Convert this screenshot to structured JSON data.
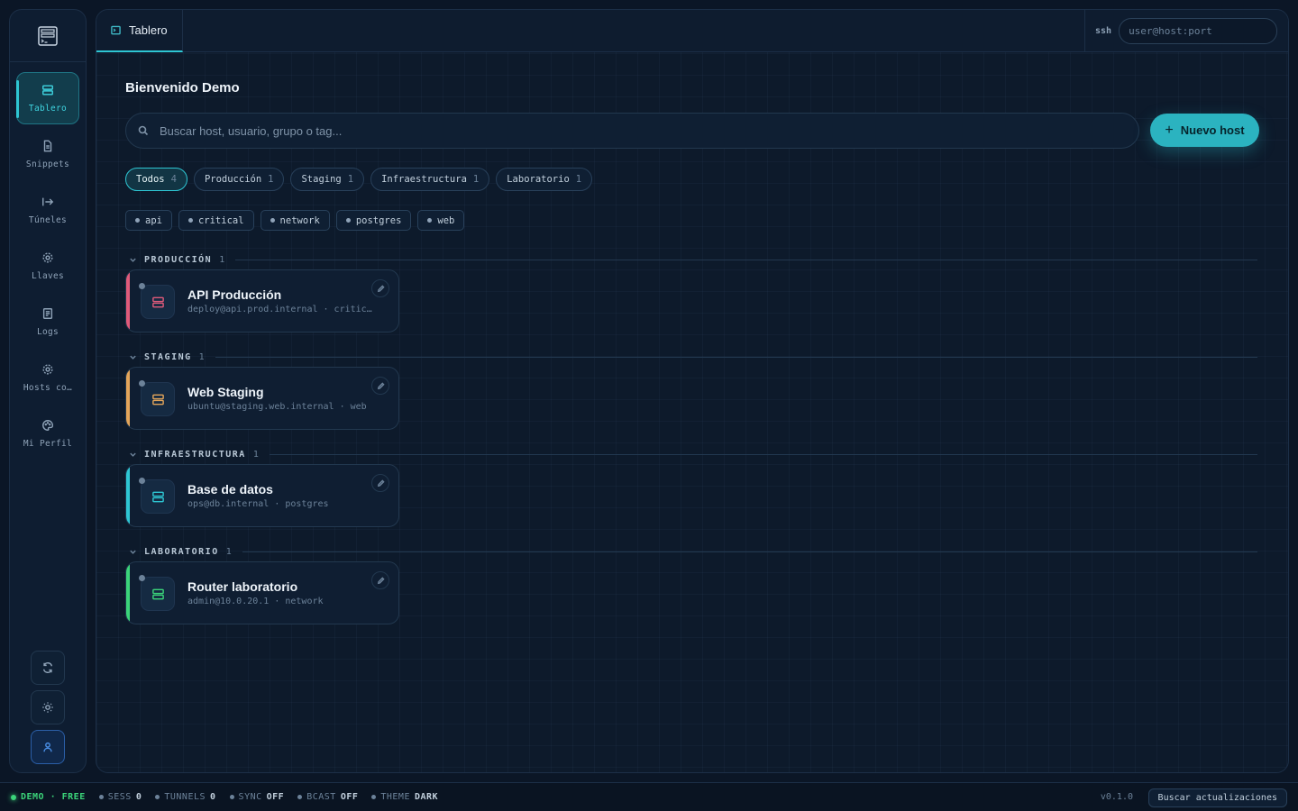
{
  "sidebar": {
    "items": [
      {
        "label": "Tablero",
        "icon": "server-icon"
      },
      {
        "label": "Snippets",
        "icon": "file-icon"
      },
      {
        "label": "Túneles",
        "icon": "arrow-right-bar-icon"
      },
      {
        "label": "Llaves",
        "icon": "gear-icon"
      },
      {
        "label": "Logs",
        "icon": "document-icon"
      },
      {
        "label": "Hosts co…",
        "icon": "gear-icon"
      },
      {
        "label": "Mi Perfil",
        "icon": "palette-icon"
      }
    ],
    "bottom_buttons": [
      "refresh-icon",
      "sun-icon",
      "user-icon"
    ]
  },
  "topbar": {
    "tab_label": "Tablero",
    "ssh_label": "ssh",
    "ssh_placeholder": "user@host:port"
  },
  "main": {
    "welcome": "Bienvenido Demo",
    "search_placeholder": "Buscar host, usuario, grupo o tag...",
    "new_host_label": "Nuevo host",
    "filters": [
      {
        "label": "Todos",
        "count": "4",
        "active": true
      },
      {
        "label": "Producción",
        "count": "1"
      },
      {
        "label": "Staging",
        "count": "1"
      },
      {
        "label": "Infraestructura",
        "count": "1"
      },
      {
        "label": "Laboratorio",
        "count": "1"
      }
    ],
    "tags": [
      "api",
      "critical",
      "network",
      "postgres",
      "web"
    ],
    "groups": [
      {
        "name": "PRODUCCIÓN",
        "count": "1",
        "hosts": [
          {
            "title": "API Producción",
            "sub": "deploy@api.prod.internal · critic…",
            "color": "#e05a7a"
          }
        ]
      },
      {
        "name": "STAGING",
        "count": "1",
        "hosts": [
          {
            "title": "Web Staging",
            "sub": "ubuntu@staging.web.internal · web",
            "color": "#e3a55a"
          }
        ]
      },
      {
        "name": "INFRAESTRUCTURA",
        "count": "1",
        "hosts": [
          {
            "title": "Base de datos",
            "sub": "ops@db.internal · postgres",
            "color": "#2ec6d3"
          }
        ]
      },
      {
        "name": "LABORATORIO",
        "count": "1",
        "hosts": [
          {
            "title": "Router laboratorio",
            "sub": "admin@10.0.20.1 · network",
            "color": "#3bd47a"
          }
        ]
      }
    ]
  },
  "statusbar": {
    "demo": "DEMO · FREE",
    "sess_label": "SESS",
    "sess_val": "0",
    "tunnels_label": "TUNNELS",
    "tunnels_val": "0",
    "sync_label": "SYNC",
    "sync_val": "OFF",
    "bcast_label": "BCAST",
    "bcast_val": "OFF",
    "theme_label": "THEME",
    "theme_val": "DARK",
    "version": "v0.1.0",
    "update_label": "Buscar actualizaciones"
  }
}
